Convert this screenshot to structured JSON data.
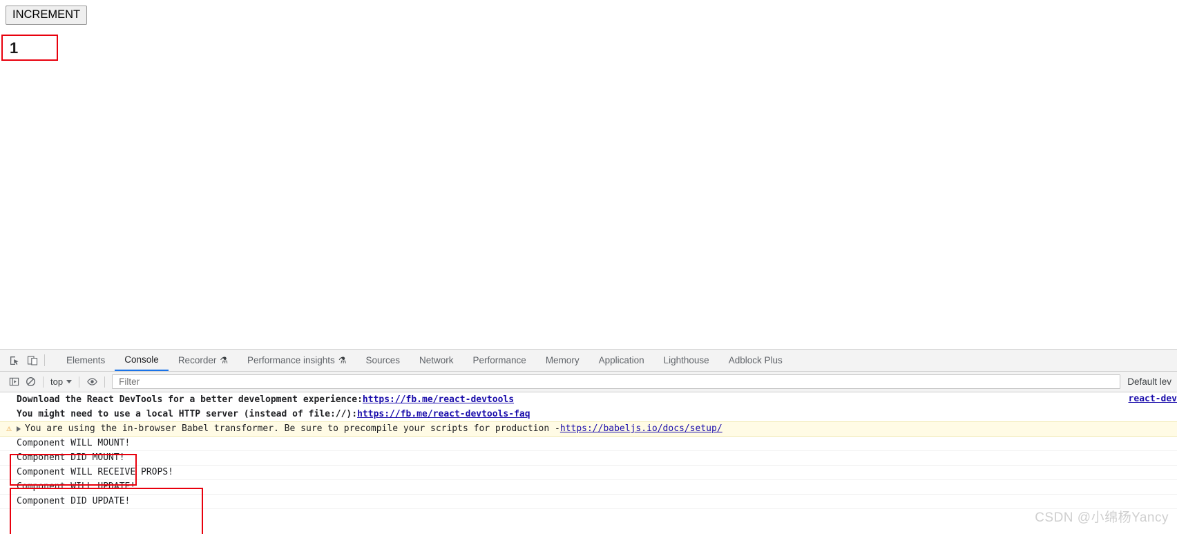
{
  "page": {
    "increment_button_label": "INCREMENT",
    "counter_value": "1",
    "highlight_color": "#e8000d"
  },
  "devtools": {
    "tool_icons": [
      {
        "name": "inspect-element-icon",
        "title": "Inspect element"
      },
      {
        "name": "device-toolbar-icon",
        "title": "Toggle device toolbar"
      }
    ],
    "tabs": [
      {
        "label": "Elements",
        "selected": false,
        "experimental": false
      },
      {
        "label": "Console",
        "selected": true,
        "experimental": false
      },
      {
        "label": "Recorder",
        "selected": false,
        "experimental": true
      },
      {
        "label": "Performance insights",
        "selected": false,
        "experimental": true
      },
      {
        "label": "Sources",
        "selected": false,
        "experimental": false
      },
      {
        "label": "Network",
        "selected": false,
        "experimental": false
      },
      {
        "label": "Performance",
        "selected": false,
        "experimental": false
      },
      {
        "label": "Memory",
        "selected": false,
        "experimental": false
      },
      {
        "label": "Application",
        "selected": false,
        "experimental": false
      },
      {
        "label": "Lighthouse",
        "selected": false,
        "experimental": false
      },
      {
        "label": "Adblock Plus",
        "selected": false,
        "experimental": false
      }
    ],
    "selected_tab_accent": "#1a73e8",
    "flask_glyph": "⚗",
    "console_toolbar": {
      "sidebar_toggle_icon": "console-sidebar-icon",
      "clear_console_icon": "clear-console-icon",
      "context_selector": "top",
      "live_expression_icon": "eye-icon",
      "filter_placeholder": "Filter",
      "filter_value": "",
      "level_selector": "Default lev"
    },
    "messages": [
      {
        "kind": "plain",
        "text": "Download the React DevTools for a better development experience: ",
        "link": "https://fb.me/react-devtools",
        "source": "react-dev"
      },
      {
        "kind": "plain",
        "text": "You might need to use a local HTTP server (instead of file://): ",
        "link": "https://fb.me/react-devtools-faq",
        "source": ""
      },
      {
        "kind": "warning",
        "text": "You are using the in-browser Babel transformer. Be sure to precompile your scripts for production - ",
        "link": "https://babeljs.io/docs/setup/",
        "source": ""
      },
      {
        "kind": "log",
        "text": "Component WILL MOUNT!"
      },
      {
        "kind": "log",
        "text": "Component DID MOUNT!"
      },
      {
        "kind": "log",
        "text": "Component WILL RECEIVE PROPS!"
      },
      {
        "kind": "log",
        "text": "Component WILL UPDATE!"
      },
      {
        "kind": "log",
        "text": "Component DID UPDATE!"
      }
    ]
  },
  "watermark": "CSDN @小绵杨Yancy"
}
